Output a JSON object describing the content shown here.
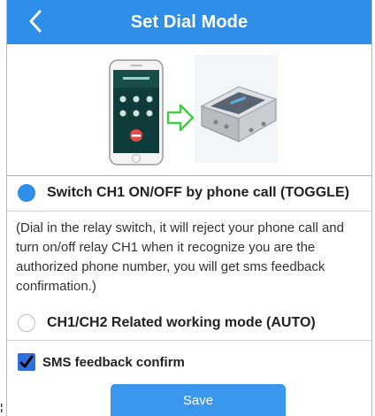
{
  "colors": {
    "header_bg": "#2f8fe8",
    "accent": "#2f8fe8",
    "checkbox": "#2f6fe0",
    "save_bg": "#3a97ee"
  },
  "header": {
    "title": "Set Dial Mode",
    "back_icon": "chevron-left-icon"
  },
  "illustration": {
    "phone_icon": "smartphone-icon",
    "arrow_icon": "arrow-right-outline-icon",
    "device_icon": "relay-box-icon"
  },
  "modes": [
    {
      "label": "Switch CH1 ON/OFF by phone call (TOGGLE)",
      "selected": true
    },
    {
      "label": "CH1/CH2 Related working mode (AUTO)",
      "selected": false
    }
  ],
  "description": "(Dial in the relay switch, it will reject your phone call and turn on/off relay CH1 when it recognize you are the authorized phone number, you will get sms feedback confirmation.)",
  "sms_feedback": {
    "label": "SMS feedback confirm",
    "checked": true
  },
  "save_label": "Save"
}
